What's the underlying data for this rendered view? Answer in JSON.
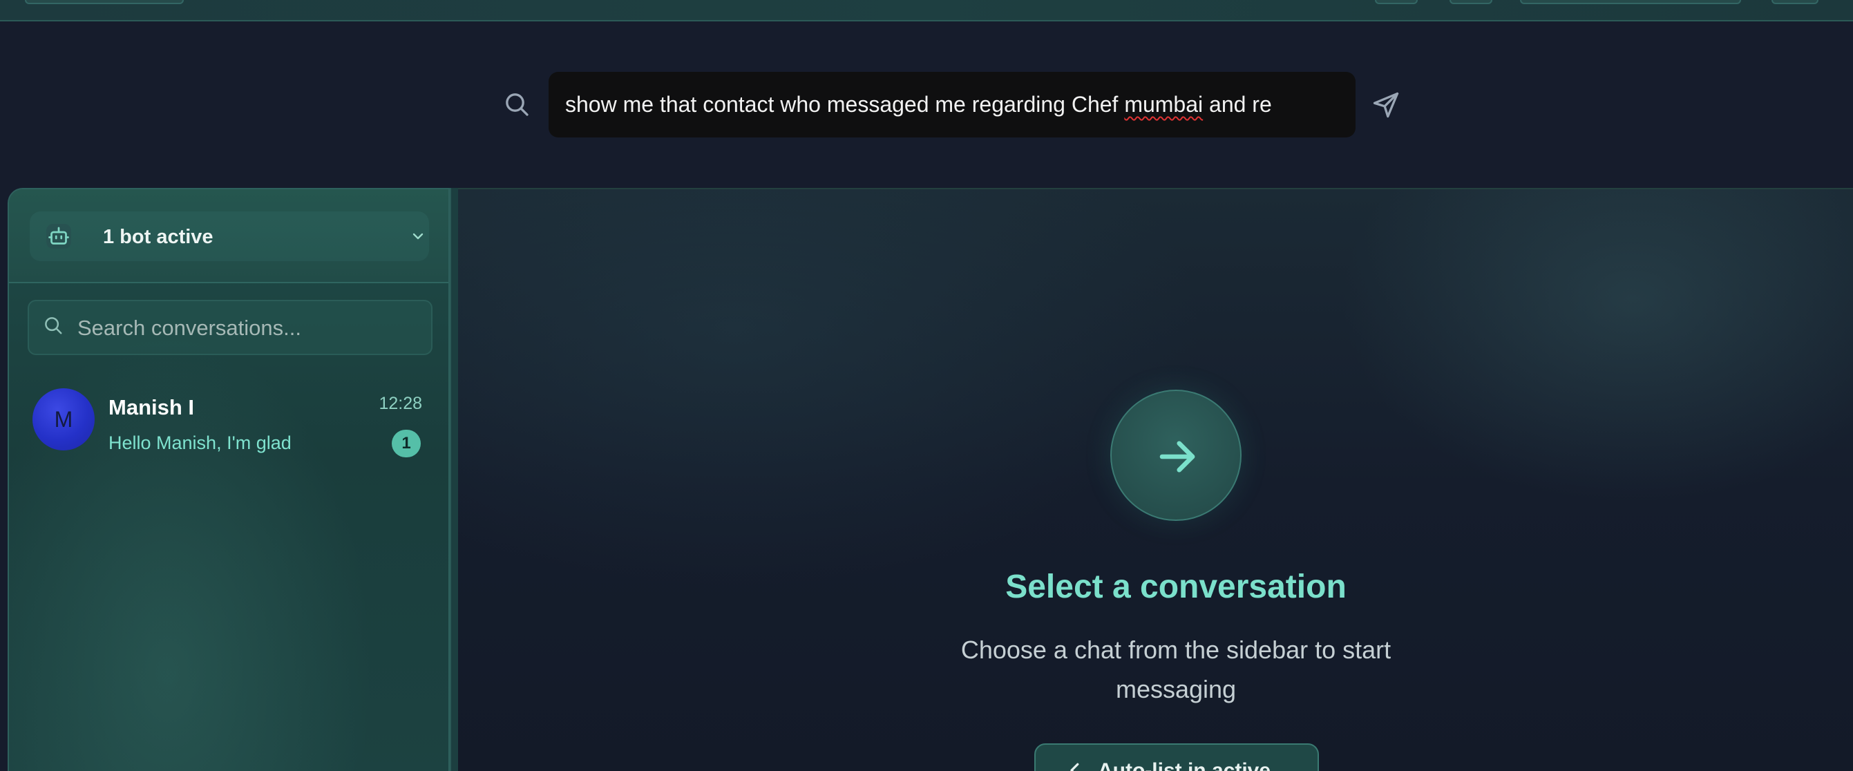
{
  "command_bar": {
    "value_parts": [
      "show me that contact who messaged me regarding Chef ",
      "mumbai",
      " and re"
    ],
    "search_icon": "search-icon",
    "send_icon": "send-icon"
  },
  "sidebar": {
    "bot_status": "1 bot active",
    "bot_icon": "bot-icon",
    "dropdown_icon": "chevron-down-icon",
    "search_placeholder": "Search conversations...",
    "conversations": [
      {
        "avatar_initial": "M",
        "avatar_color": "#2b36d0",
        "name": "Manish I",
        "time": "12:28",
        "preview": "Hello Manish, I'm glad",
        "unread": "1"
      }
    ]
  },
  "main": {
    "icon": "arrow-right-icon",
    "title": "Select a conversation",
    "subtitle": "Choose a chat from the sidebar to start messaging",
    "button_label": "Auto-list in active"
  },
  "colors": {
    "accent": "#7be0cb",
    "sidebar_bg": "#1f4a47",
    "page_bg": "#161c2c",
    "input_bg": "#0f0f10",
    "badge": "#55bfa8"
  }
}
